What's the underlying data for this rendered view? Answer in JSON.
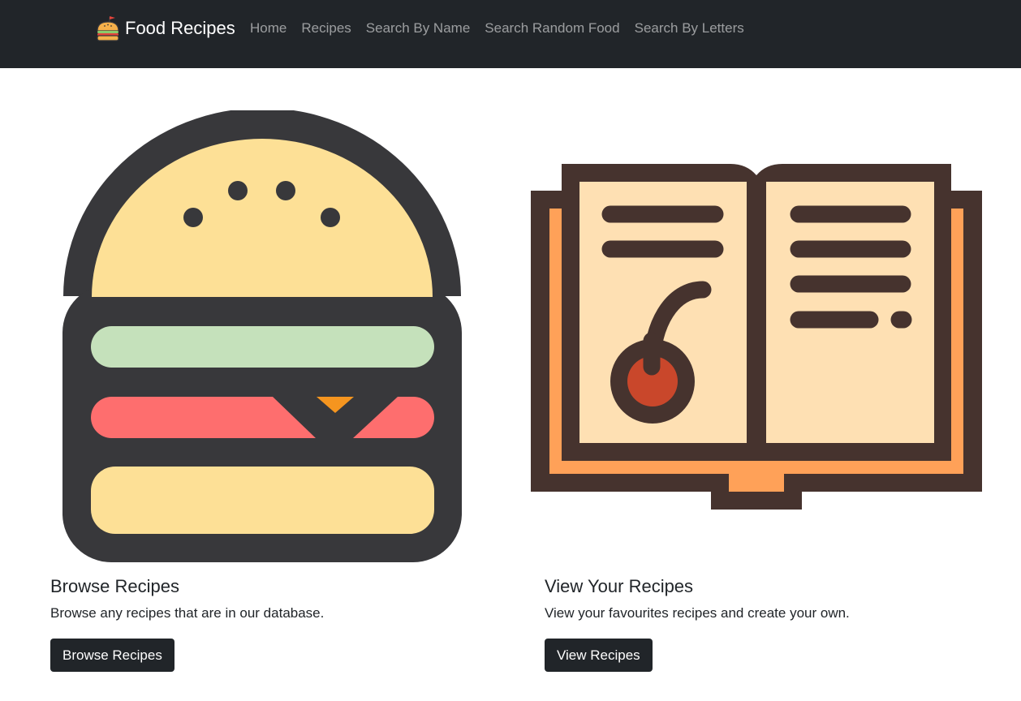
{
  "navbar": {
    "brand": {
      "text": "Food Recipes",
      "icon": "burger-icon"
    },
    "links": [
      {
        "label": "Home"
      },
      {
        "label": "Recipes"
      },
      {
        "label": "Search By Name"
      },
      {
        "label": "Search Random Food"
      },
      {
        "label": "Search By Letters"
      }
    ]
  },
  "cards": [
    {
      "image": "burger-illustration",
      "title": "Browse Recipes",
      "text": "Browse any recipes that are in our database.",
      "button": "Browse Recipes"
    },
    {
      "image": "recipe-book-illustration",
      "title": "View Your Recipes",
      "text": "View your favourites recipes and create your own.",
      "button": "View Recipes"
    }
  ],
  "colors": {
    "navbar_bg": "#212529",
    "button_bg": "#212529",
    "burger_outline": "#38383b",
    "bun": "#fde096",
    "lettuce": "#c5e1bb",
    "tomato": "#fe6e6e",
    "cheese": "#f5951f",
    "book_outline": "#46332e",
    "book_page": "#fee0b3",
    "book_cover": "#ffa158",
    "cherry": "#c9472b"
  }
}
